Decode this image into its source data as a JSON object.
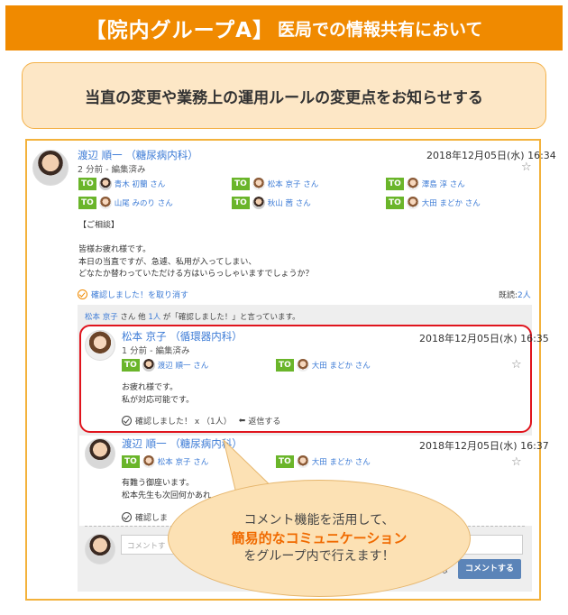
{
  "banner": {
    "title_main": "【院内グループA】",
    "title_sub": "医局での情報共有において"
  },
  "subtitle": "当直の変更や業務上の運用ルールの変更点をお知らせする",
  "post": {
    "author": "渡辺 順一 （糖尿病内科）",
    "edited": "2 分前 - 編集済み",
    "date": "2018年12月05日(水) 16:34",
    "star": "☆",
    "to_label": "TO",
    "recipients": [
      "青木 初蘭 さん",
      "松本 京子 さん",
      "澤島 淳 さん",
      "山尾 みのり さん",
      "秋山 茜 さん",
      "大田 まどか さん"
    ],
    "body": "【ご相談】\n\n皆様お疲れ様です。\n本日の当直ですが、急遽、私用が入ってしまい、\nどなたか替わっていただける方はいらっしゃいますでしょうか？",
    "confirm_cancel": "確認しました！を取り消す",
    "read_label": "既読:",
    "read_count": "2人"
  },
  "note": {
    "name": "松本 京子",
    "mid": " さん 他 ",
    "count": "1人",
    "rest": " が「確認しました！」と言っています。"
  },
  "comments": [
    {
      "author": "松本 京子 （循環器内科）",
      "edited": "1 分前 - 編集済み",
      "date": "2018年12月05日(水) 16:35",
      "recipients": [
        "渡辺 順一 さん",
        "大田 まどか さん"
      ],
      "body": "お疲れ様です。\n私が対応可能です。",
      "confirm": "確認しました！ x （1人）",
      "reply": "返信する"
    },
    {
      "author": "渡辺 順一 （糖尿病内科）",
      "date": "2018年12月05日(水) 16:37",
      "recipients": [
        "松本 京子 さん",
        "大田 まどか さん"
      ],
      "body": "有難う御座います。\n松本先生も次回何かあれ",
      "confirm": "確認しま"
    }
  ],
  "input_placeholder": "コメントす",
  "resp_label": "応",
  "submit_label": "コメントする",
  "bubble": {
    "line1": "コメント機能を活用して、",
    "line2": "簡易的なコミュニケーション",
    "line3": "をグループ内で行えます！"
  }
}
